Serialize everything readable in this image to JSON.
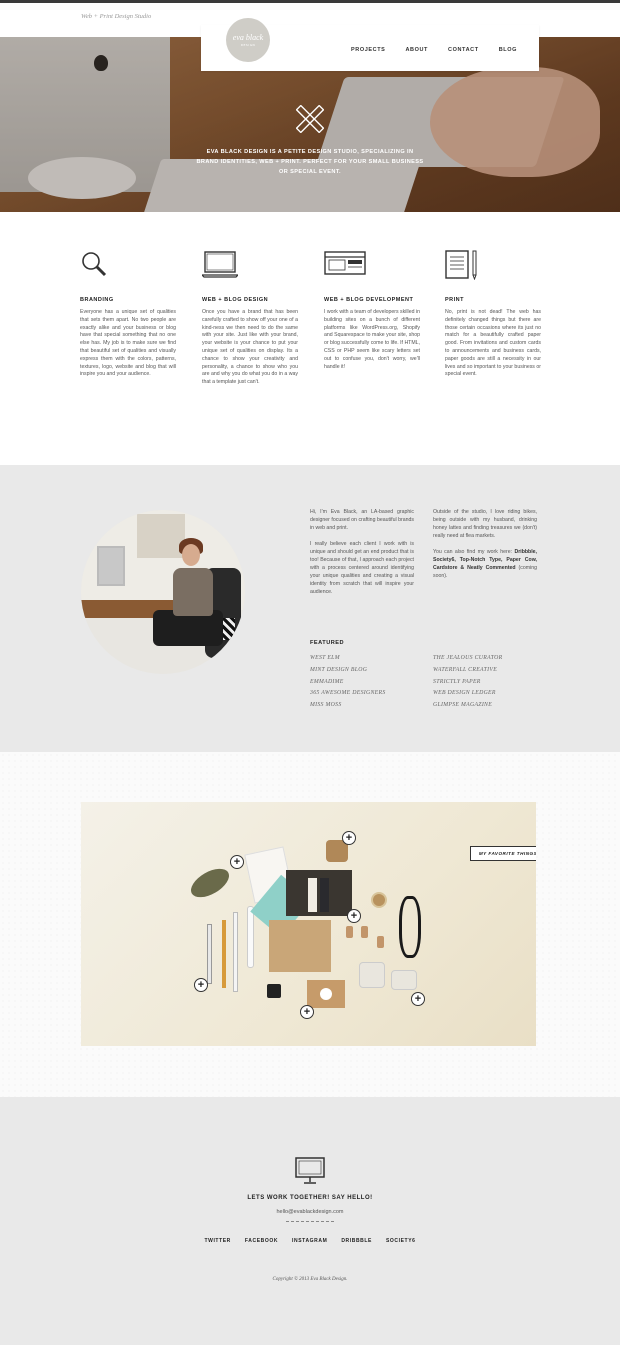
{
  "site": {
    "tagline": "Web + Print Design Studio",
    "logo_line1": "eva black",
    "logo_line2": "DESIGN"
  },
  "nav": {
    "items": [
      "PROJECTS",
      "ABOUT",
      "CONTACT",
      "BLOG"
    ]
  },
  "hero": {
    "text": "EVA BLACK DESIGN IS A PETITE DESIGN STUDIO, SPECIALIZING IN BRAND IDENTITIES, WEB + PRINT. PERFECT FOR YOUR SMALL BUSINESS OR SPECIAL EVENT."
  },
  "services": [
    {
      "icon": "magnifier-icon",
      "title": "BRANDING",
      "text": "Everyone has a unique set of qualities that sets them apart. No two people are exactly alike and your business or blog have that special something that no one else has. My job is to make sure we find that beautiful set of qualities and visually express them with the colors, patterns, textures, logo, website and blog that will inspire you and your audience."
    },
    {
      "icon": "laptop-icon",
      "title": "WEB + BLOG DESIGN",
      "text": "Once you have a brand that has been carefully crafted to show off your one of a kind-ness we then need to do the same with your site. Just like with your brand, your website is your chance to put your unique set of qualities on display. Its a chance to show your creativity and personality, a chance to show who you are and why you do what you do in a way that a template just can't."
    },
    {
      "icon": "browser-window-icon",
      "title": "WEB + BLOG DEVELOPMENT",
      "text": "I work with a team of developers skilled in building sites on a bunch of different platforms like WordPress.org, Shopify and Squarespace to make your site, shop or blog successfully come to life. If HTML, CSS or PHP seem like scary letters set out to confuse you, don't worry, we'll handle it!"
    },
    {
      "icon": "paper-pencil-icon",
      "title": "PRINT",
      "text": "No, print is not dead! The web has definitely changed things but there are those certain occasions where its just no match for a beautifully crafted paper good. From invitations and custom cards to announcements and business cards, paper goods are still a necessity in our lives and so important to your business or special event."
    }
  ],
  "about": {
    "col1": [
      "Hi, I'm Eva Black, an LA-based graphic designer focused on crafting beautiful brands in web and print.",
      "I really believe each client I work with is unique and should get an end product that is too! Because of that, I approach each project with a process centered around identifying your unique qualities and creating a visual identity from scratch that will inspire your audience."
    ],
    "col2_p1": "Outside of the studio, I love riding bikes, being outside with my husband, drinking honey lattes and finding treasures we (don't) really need at flea markets.",
    "col2_p2_lead": "You can also find my work here: ",
    "col2_p2_links": "Dribbble, Society6, Top-Notch Type, Paper Cow, Cardstore & Neatly Commented",
    "col2_p2_tail": " (coming soon).",
    "featured_title": "FEATURED",
    "featured_left": [
      "WEST ELM",
      "MINT DESIGN BLOG",
      "EMMADIME",
      "365 AWESOME DESIGNERS",
      "MISS MOSS"
    ],
    "featured_right": [
      "THE JEALOUS CURATOR",
      "WATERFALL CREATIVE",
      "STRICTLY PAPER",
      "WEB DESIGN LEDGER",
      "GLIMPSE MAGAZINE"
    ]
  },
  "favorites": {
    "ribbon": "MY FAVORITE THINGS",
    "plus_glyph": "+"
  },
  "footer": {
    "icon": "desktop-monitor-icon",
    "title": "LETS WORK TOGETHER! SAY HELLO!",
    "email": "hello@evablackdesign.com",
    "social": [
      "TWITTER",
      "FACEBOOK",
      "INSTAGRAM",
      "DRIBBBLE",
      "SOCIETY6"
    ],
    "copyright": "Copyright © 2013 Eva Black Design."
  }
}
